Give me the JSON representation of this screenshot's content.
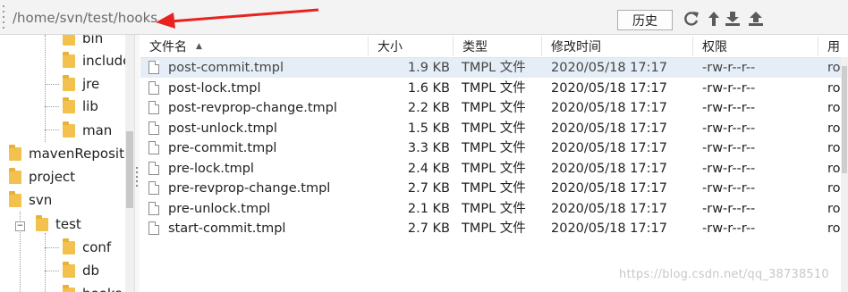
{
  "toolbar": {
    "path": "/home/svn/test/hooks",
    "history_label": "历史",
    "tools": [
      "refresh-icon",
      "upload-icon",
      "download-icon",
      "upload-up-icon"
    ]
  },
  "tree": {
    "items": [
      {
        "label": "bin"
      },
      {
        "label": "include"
      },
      {
        "label": "jre"
      },
      {
        "label": "lib"
      },
      {
        "label": "man"
      },
      {
        "label": "mavenReposito"
      },
      {
        "label": "project"
      },
      {
        "label": "svn"
      },
      {
        "label": "test"
      },
      {
        "label": "conf"
      },
      {
        "label": "db"
      },
      {
        "label": "hooks"
      }
    ]
  },
  "table": {
    "columns": [
      "文件名",
      "大小",
      "类型",
      "修改时间",
      "权限",
      "用"
    ],
    "rows": [
      {
        "name": "post-commit.tmpl",
        "size": "1.9 KB",
        "type": "TMPL 文件",
        "modified": "2020/05/18 17:17",
        "perm": "-rw-r--r--",
        "owner": "ro"
      },
      {
        "name": "post-lock.tmpl",
        "size": "1.6 KB",
        "type": "TMPL 文件",
        "modified": "2020/05/18 17:17",
        "perm": "-rw-r--r--",
        "owner": "ro"
      },
      {
        "name": "post-revprop-change.tmpl",
        "size": "2.2 KB",
        "type": "TMPL 文件",
        "modified": "2020/05/18 17:17",
        "perm": "-rw-r--r--",
        "owner": "ro"
      },
      {
        "name": "post-unlock.tmpl",
        "size": "1.5 KB",
        "type": "TMPL 文件",
        "modified": "2020/05/18 17:17",
        "perm": "-rw-r--r--",
        "owner": "ro"
      },
      {
        "name": "pre-commit.tmpl",
        "size": "3.3 KB",
        "type": "TMPL 文件",
        "modified": "2020/05/18 17:17",
        "perm": "-rw-r--r--",
        "owner": "ro"
      },
      {
        "name": "pre-lock.tmpl",
        "size": "2.4 KB",
        "type": "TMPL 文件",
        "modified": "2020/05/18 17:17",
        "perm": "-rw-r--r--",
        "owner": "ro"
      },
      {
        "name": "pre-revprop-change.tmpl",
        "size": "2.7 KB",
        "type": "TMPL 文件",
        "modified": "2020/05/18 17:17",
        "perm": "-rw-r--r--",
        "owner": "ro"
      },
      {
        "name": "pre-unlock.tmpl",
        "size": "2.1 KB",
        "type": "TMPL 文件",
        "modified": "2020/05/18 17:17",
        "perm": "-rw-r--r--",
        "owner": "ro"
      },
      {
        "name": "start-commit.tmpl",
        "size": "2.7 KB",
        "type": "TMPL 文件",
        "modified": "2020/05/18 17:17",
        "perm": "-rw-r--r--",
        "owner": "ro"
      }
    ]
  },
  "watermark": "https://blog.csdn.net/qq_38738510",
  "colors": {
    "arrow": "#e8231f",
    "folder": "#f2c14e",
    "selected_row": "#e5eef6"
  }
}
